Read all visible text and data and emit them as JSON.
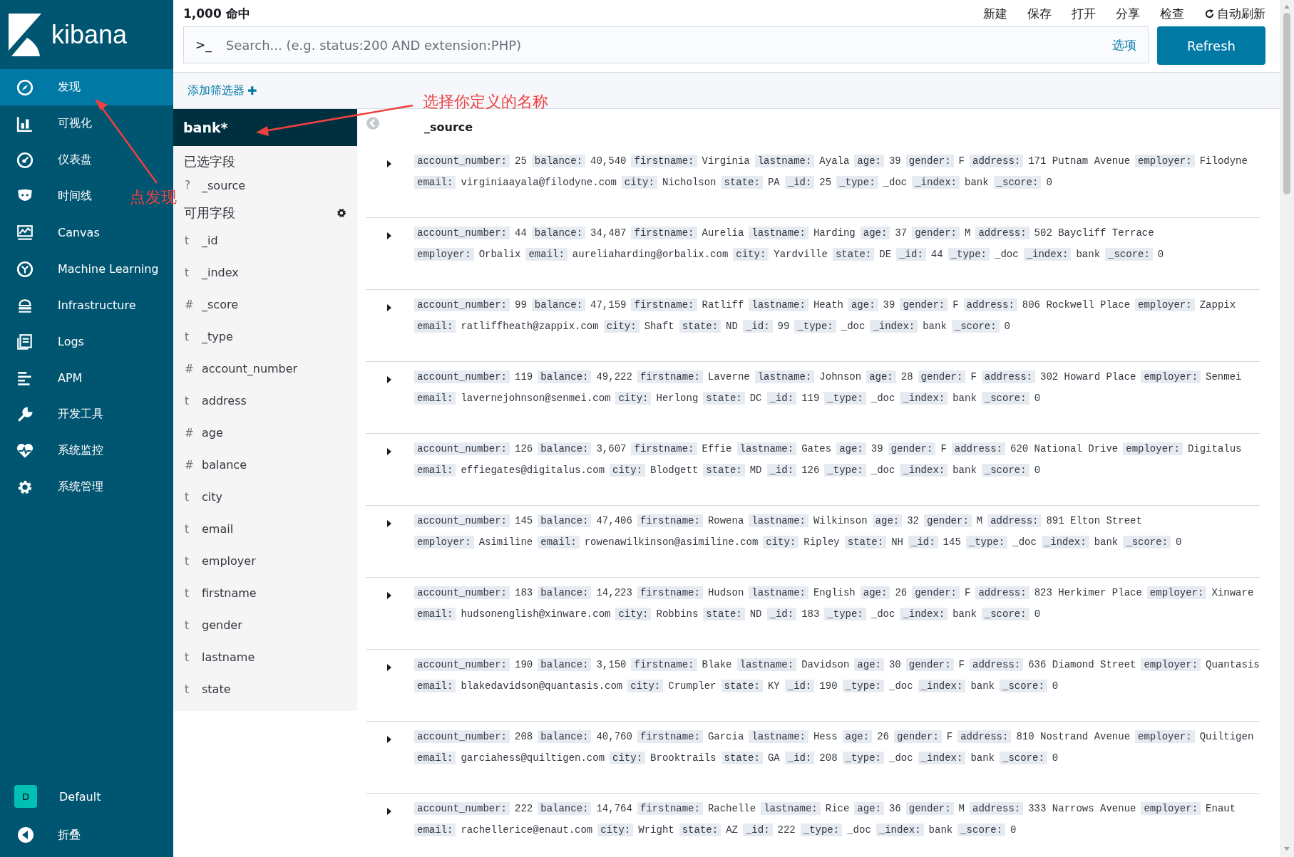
{
  "sidebar": {
    "logo_text": "kibana",
    "items": [
      {
        "label": "发现",
        "selected": true
      },
      {
        "label": "可视化",
        "selected": false
      },
      {
        "label": "仪表盘",
        "selected": false
      },
      {
        "label": "时间线",
        "selected": false
      },
      {
        "label": "Canvas",
        "selected": false
      },
      {
        "label": "Machine Learning",
        "selected": false
      },
      {
        "label": "Infrastructure",
        "selected": false
      },
      {
        "label": "Logs",
        "selected": false
      },
      {
        "label": "APM",
        "selected": false
      },
      {
        "label": "开发工具",
        "selected": false
      },
      {
        "label": "系统监控",
        "selected": false
      },
      {
        "label": "系统管理",
        "selected": false
      }
    ],
    "space": {
      "badge": "D",
      "label": "Default",
      "color": "#00bfb3"
    },
    "collapse": {
      "label": "折叠"
    }
  },
  "top_bar": {
    "hits": "1,000 命中",
    "menu": [
      "新建",
      "保存",
      "打开",
      "分享",
      "检查"
    ],
    "auto_refresh": "自动刷新",
    "search": {
      "prompt": ">_",
      "placeholder": "Search... (e.g. status:200 AND extension:PHP)",
      "options": "选项"
    },
    "refresh_button": "Refresh"
  },
  "filter_bar": {
    "add_filter": "添加筛选器",
    "add_icon": "✚"
  },
  "field_panel": {
    "index_pattern": "bank*",
    "selected_header": "已选字段",
    "selected_fields": [
      {
        "type": "?",
        "name": "_source"
      }
    ],
    "available_header": "可用字段",
    "available_fields": [
      {
        "type": "t",
        "name": "_id"
      },
      {
        "type": "t",
        "name": "_index"
      },
      {
        "type": "#",
        "name": "_score"
      },
      {
        "type": "t",
        "name": "_type"
      },
      {
        "type": "#",
        "name": "account_number"
      },
      {
        "type": "t",
        "name": "address"
      },
      {
        "type": "#",
        "name": "age"
      },
      {
        "type": "#",
        "name": "balance"
      },
      {
        "type": "t",
        "name": "city"
      },
      {
        "type": "t",
        "name": "email"
      },
      {
        "type": "t",
        "name": "employer"
      },
      {
        "type": "t",
        "name": "firstname"
      },
      {
        "type": "t",
        "name": "gender"
      },
      {
        "type": "t",
        "name": "lastname"
      },
      {
        "type": "t",
        "name": "state"
      }
    ]
  },
  "documents": {
    "column": "_source",
    "rows": [
      {
        "expanded": false,
        "fields": [
          [
            "account_number:",
            "25"
          ],
          [
            "balance:",
            "40,540"
          ],
          [
            "firstname:",
            "Virginia"
          ],
          [
            "lastname:",
            "Ayala"
          ],
          [
            "age:",
            "39"
          ],
          [
            "gender:",
            "F"
          ],
          [
            "address:",
            "171 Putnam Avenue"
          ],
          [
            "employer:",
            "Filodyne"
          ],
          [
            "email:",
            "virginiaayala@filodyne.com"
          ],
          [
            "city:",
            "Nicholson"
          ],
          [
            "state:",
            "PA"
          ],
          [
            "_id:",
            "25"
          ],
          [
            "_type:",
            "_doc"
          ],
          [
            "_index:",
            "bank"
          ],
          [
            "_score:",
            "0"
          ]
        ]
      },
      {
        "expanded": false,
        "fields": [
          [
            "account_number:",
            "44"
          ],
          [
            "balance:",
            "34,487"
          ],
          [
            "firstname:",
            "Aurelia"
          ],
          [
            "lastname:",
            "Harding"
          ],
          [
            "age:",
            "37"
          ],
          [
            "gender:",
            "M"
          ],
          [
            "address:",
            "502 Baycliff Terrace"
          ],
          [
            "employer:",
            "Orbalix"
          ],
          [
            "email:",
            "aureliaharding@orbalix.com"
          ],
          [
            "city:",
            "Yardville"
          ],
          [
            "state:",
            "DE"
          ],
          [
            "_id:",
            "44"
          ],
          [
            "_type:",
            "_doc"
          ],
          [
            "_index:",
            "bank"
          ],
          [
            "_score:",
            "0"
          ]
        ]
      },
      {
        "expanded": false,
        "fields": [
          [
            "account_number:",
            "99"
          ],
          [
            "balance:",
            "47,159"
          ],
          [
            "firstname:",
            "Ratliff"
          ],
          [
            "lastname:",
            "Heath"
          ],
          [
            "age:",
            "39"
          ],
          [
            "gender:",
            "F"
          ],
          [
            "address:",
            "806 Rockwell Place"
          ],
          [
            "employer:",
            "Zappix"
          ],
          [
            "email:",
            "ratliffheath@zappix.com"
          ],
          [
            "city:",
            "Shaft"
          ],
          [
            "state:",
            "ND"
          ],
          [
            "_id:",
            "99"
          ],
          [
            "_type:",
            "_doc"
          ],
          [
            "_index:",
            "bank"
          ],
          [
            "_score:",
            "0"
          ]
        ]
      },
      {
        "expanded": false,
        "fields": [
          [
            "account_number:",
            "119"
          ],
          [
            "balance:",
            "49,222"
          ],
          [
            "firstname:",
            "Laverne"
          ],
          [
            "lastname:",
            "Johnson"
          ],
          [
            "age:",
            "28"
          ],
          [
            "gender:",
            "F"
          ],
          [
            "address:",
            "302 Howard Place"
          ],
          [
            "employer:",
            "Senmei"
          ],
          [
            "email:",
            "lavernejohnson@senmei.com"
          ],
          [
            "city:",
            "Herlong"
          ],
          [
            "state:",
            "DC"
          ],
          [
            "_id:",
            "119"
          ],
          [
            "_type:",
            "_doc"
          ],
          [
            "_index:",
            "bank"
          ],
          [
            "_score:",
            "0"
          ]
        ]
      },
      {
        "expanded": false,
        "fields": [
          [
            "account_number:",
            "126"
          ],
          [
            "balance:",
            "3,607"
          ],
          [
            "firstname:",
            "Effie"
          ],
          [
            "lastname:",
            "Gates"
          ],
          [
            "age:",
            "39"
          ],
          [
            "gender:",
            "F"
          ],
          [
            "address:",
            "620 National Drive"
          ],
          [
            "employer:",
            "Digitalus"
          ],
          [
            "email:",
            "effiegates@digitalus.com"
          ],
          [
            "city:",
            "Blodgett"
          ],
          [
            "state:",
            "MD"
          ],
          [
            "_id:",
            "126"
          ],
          [
            "_type:",
            "_doc"
          ],
          [
            "_index:",
            "bank"
          ],
          [
            "_score:",
            "0"
          ]
        ]
      },
      {
        "expanded": false,
        "fields": [
          [
            "account_number:",
            "145"
          ],
          [
            "balance:",
            "47,406"
          ],
          [
            "firstname:",
            "Rowena"
          ],
          [
            "lastname:",
            "Wilkinson"
          ],
          [
            "age:",
            "32"
          ],
          [
            "gender:",
            "M"
          ],
          [
            "address:",
            "891 Elton Street"
          ],
          [
            "employer:",
            "Asimiline"
          ],
          [
            "email:",
            "rowenawilkinson@asimiline.com"
          ],
          [
            "city:",
            "Ripley"
          ],
          [
            "state:",
            "NH"
          ],
          [
            "_id:",
            "145"
          ],
          [
            "_type:",
            "_doc"
          ],
          [
            "_index:",
            "bank"
          ],
          [
            "_score:",
            "0"
          ]
        ]
      },
      {
        "expanded": false,
        "fields": [
          [
            "account_number:",
            "183"
          ],
          [
            "balance:",
            "14,223"
          ],
          [
            "firstname:",
            "Hudson"
          ],
          [
            "lastname:",
            "English"
          ],
          [
            "age:",
            "26"
          ],
          [
            "gender:",
            "F"
          ],
          [
            "address:",
            "823 Herkimer Place"
          ],
          [
            "employer:",
            "Xinware"
          ],
          [
            "email:",
            "hudsonenglish@xinware.com"
          ],
          [
            "city:",
            "Robbins"
          ],
          [
            "state:",
            "ND"
          ],
          [
            "_id:",
            "183"
          ],
          [
            "_type:",
            "_doc"
          ],
          [
            "_index:",
            "bank"
          ],
          [
            "_score:",
            "0"
          ]
        ]
      },
      {
        "expanded": false,
        "fields": [
          [
            "account_number:",
            "190"
          ],
          [
            "balance:",
            "3,150"
          ],
          [
            "firstname:",
            "Blake"
          ],
          [
            "lastname:",
            "Davidson"
          ],
          [
            "age:",
            "30"
          ],
          [
            "gender:",
            "F"
          ],
          [
            "address:",
            "636 Diamond Street"
          ],
          [
            "employer:",
            "Quantasis"
          ],
          [
            "email:",
            "blakedavidson@quantasis.com"
          ],
          [
            "city:",
            "Crumpler"
          ],
          [
            "state:",
            "KY"
          ],
          [
            "_id:",
            "190"
          ],
          [
            "_type:",
            "_doc"
          ],
          [
            "_index:",
            "bank"
          ],
          [
            "_score:",
            "0"
          ]
        ]
      },
      {
        "expanded": false,
        "fields": [
          [
            "account_number:",
            "208"
          ],
          [
            "balance:",
            "40,760"
          ],
          [
            "firstname:",
            "Garcia"
          ],
          [
            "lastname:",
            "Hess"
          ],
          [
            "age:",
            "26"
          ],
          [
            "gender:",
            "F"
          ],
          [
            "address:",
            "810 Nostrand Avenue"
          ],
          [
            "employer:",
            "Quiltigen"
          ],
          [
            "email:",
            "garciahess@quiltigen.com"
          ],
          [
            "city:",
            "Brooktrails"
          ],
          [
            "state:",
            "GA"
          ],
          [
            "_id:",
            "208"
          ],
          [
            "_type:",
            "_doc"
          ],
          [
            "_index:",
            "bank"
          ],
          [
            "_score:",
            "0"
          ]
        ]
      },
      {
        "expanded": false,
        "fields": [
          [
            "account_number:",
            "222"
          ],
          [
            "balance:",
            "14,764"
          ],
          [
            "firstname:",
            "Rachelle"
          ],
          [
            "lastname:",
            "Rice"
          ],
          [
            "age:",
            "36"
          ],
          [
            "gender:",
            "M"
          ],
          [
            "address:",
            "333 Narrows Avenue"
          ],
          [
            "employer:",
            "Enaut"
          ],
          [
            "email:",
            "rachellerice@enaut.com"
          ],
          [
            "city:",
            "Wright"
          ],
          [
            "state:",
            "AZ"
          ],
          [
            "_id:",
            "222"
          ],
          [
            "_type:",
            "_doc"
          ],
          [
            "_index:",
            "bank"
          ],
          [
            "_score:",
            "0"
          ]
        ]
      }
    ]
  },
  "annotations": [
    {
      "text": "点发现"
    },
    {
      "text": "选择你定义的名称"
    }
  ]
}
